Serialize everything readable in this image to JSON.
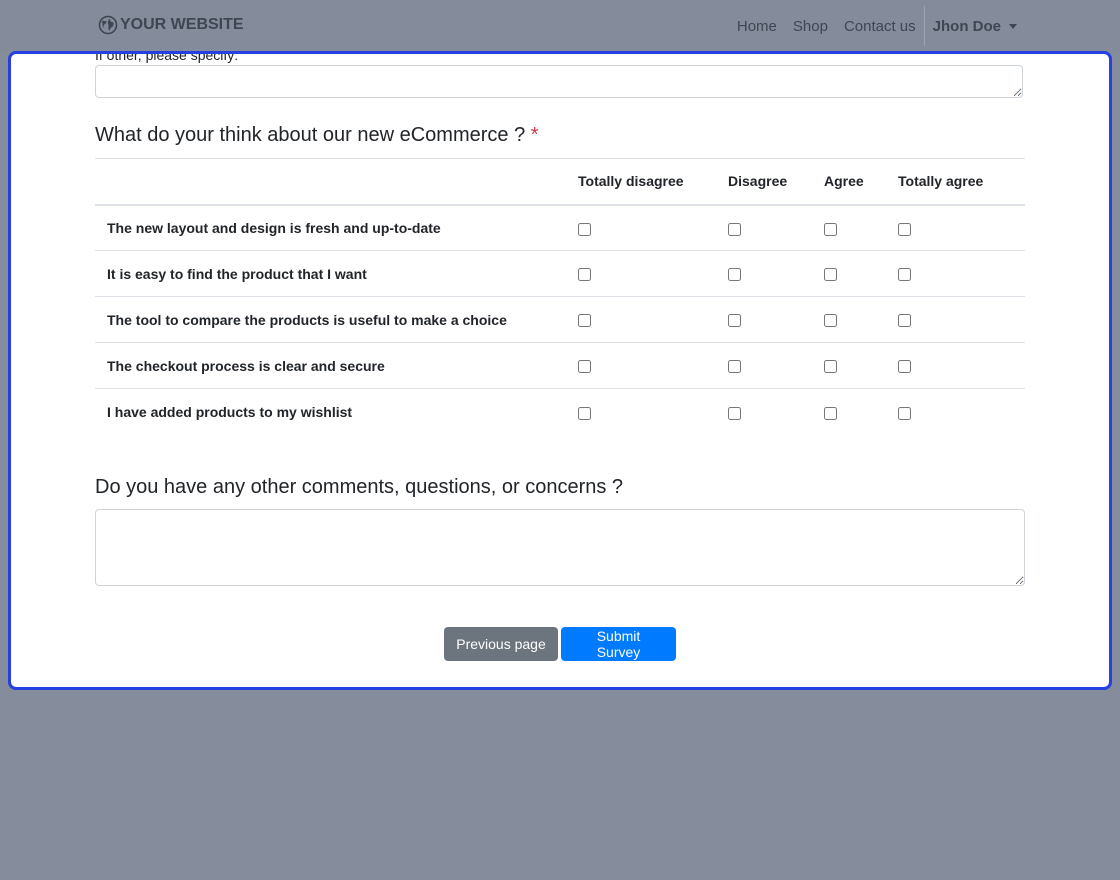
{
  "navbar": {
    "brand": "YOUR WEBSITE",
    "links": [
      "Home",
      "Shop",
      "Contact us"
    ],
    "user": "Jhon Doe"
  },
  "form": {
    "other_label": "If other, please specify:",
    "other_value": "",
    "question1": {
      "title": "What do your think about our new eCommerce ?",
      "required_mark": "*",
      "columns": [
        "Totally disagree",
        "Disagree",
        "Agree",
        "Totally agree"
      ],
      "rows": [
        "The new layout and design is fresh and up-to-date",
        "It is easy to find the product that I want",
        "The tool to compare the products is useful to make a choice",
        "The checkout process is clear and secure",
        "I have added products to my wishlist"
      ]
    },
    "question2": {
      "title": "Do you have any other comments, questions, or concerns ?",
      "value": ""
    },
    "buttons": {
      "previous": "Previous page",
      "submit": "Submit Survey"
    }
  },
  "colors": {
    "primary": "#007bff",
    "secondary": "#6c757d",
    "required": "#dc3545",
    "overlay": "#858c9c",
    "panel_border": "#2440e0"
  }
}
